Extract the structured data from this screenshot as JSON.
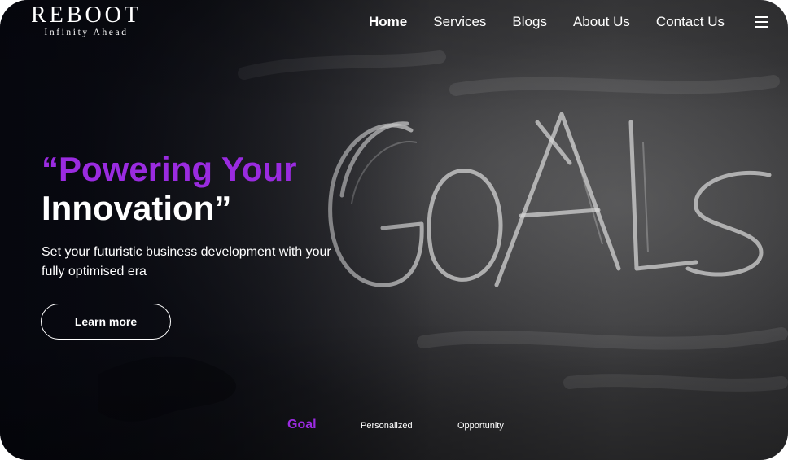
{
  "brand": {
    "name": "REBOOT",
    "tagline": "Infinity Ahead"
  },
  "nav": {
    "items": [
      {
        "label": "Home",
        "active": true
      },
      {
        "label": "Services",
        "active": false
      },
      {
        "label": "Blogs",
        "active": false
      },
      {
        "label": "About Us",
        "active": false
      },
      {
        "label": "Contact Us",
        "active": false
      }
    ],
    "menu_icon": "hamburger-menu-icon"
  },
  "hero": {
    "title_line1": "“Powering Your",
    "title_line2": "Innovation”",
    "subtitle": "Set your futuristic business development with your fully optimised era",
    "cta_label": "Learn more",
    "background_image": "chalkboard with the word GOALS written in chalk"
  },
  "tabs": [
    {
      "label": "Goal",
      "active": true
    },
    {
      "label": "Personalized",
      "active": false
    },
    {
      "label": "Opportunity",
      "active": false
    }
  ],
  "colors": {
    "accent": "#9a2be0",
    "text": "#ffffff",
    "background": "#1c1d22"
  }
}
